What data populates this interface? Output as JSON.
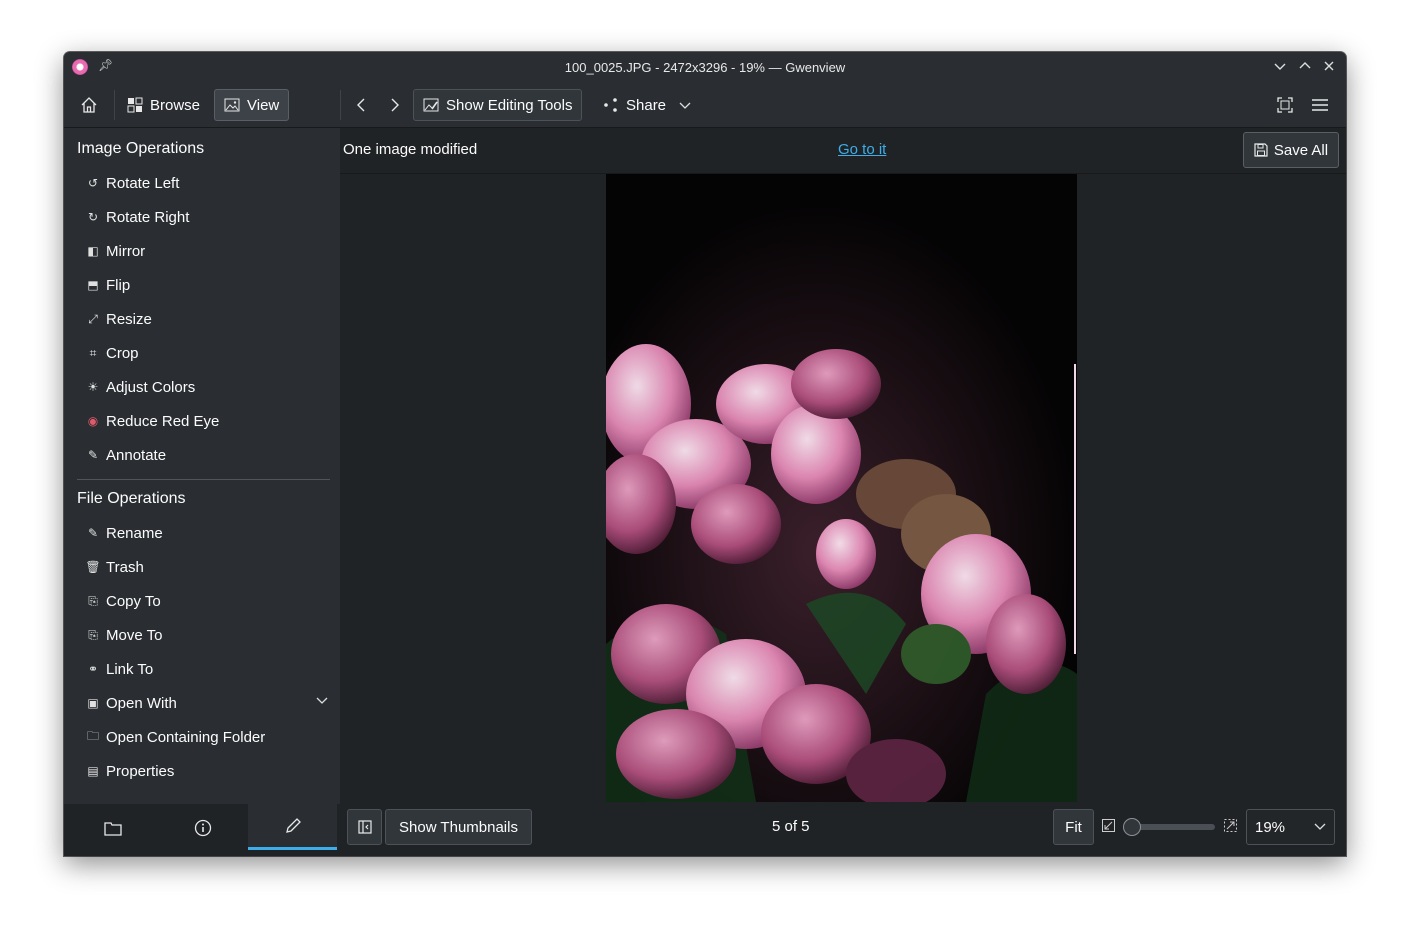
{
  "window": {
    "title": "100_0025.JPG - 2472x3296 - 19% — Gwenview"
  },
  "toolbar": {
    "browse_label": "Browse",
    "view_label": "View",
    "show_editing_tools_label": "Show Editing Tools",
    "share_label": "Share"
  },
  "sidebar": {
    "image_ops_title": "Image Operations",
    "image_ops": [
      {
        "label": "Rotate Left",
        "icon": "rotate-left-icon"
      },
      {
        "label": "Rotate Right",
        "icon": "rotate-right-icon"
      },
      {
        "label": "Mirror",
        "icon": "mirror-icon"
      },
      {
        "label": "Flip",
        "icon": "flip-icon"
      },
      {
        "label": "Resize",
        "icon": "resize-icon"
      },
      {
        "label": "Crop",
        "icon": "crop-icon"
      },
      {
        "label": "Adjust Colors",
        "icon": "adjust-colors-icon"
      },
      {
        "label": "Reduce Red Eye",
        "icon": "red-eye-icon"
      },
      {
        "label": "Annotate",
        "icon": "annotate-icon"
      }
    ],
    "file_ops_title": "File Operations",
    "file_ops": [
      {
        "label": "Rename",
        "icon": "rename-icon"
      },
      {
        "label": "Trash",
        "icon": "trash-icon"
      },
      {
        "label": "Copy To",
        "icon": "copy-icon"
      },
      {
        "label": "Move To",
        "icon": "move-icon"
      },
      {
        "label": "Link To",
        "icon": "link-icon"
      },
      {
        "label": "Open With",
        "icon": "open-with-icon"
      },
      {
        "label": "Open Containing Folder",
        "icon": "folder-icon"
      },
      {
        "label": "Properties",
        "icon": "properties-icon"
      }
    ]
  },
  "banner": {
    "message": "One image modified",
    "link": "Go to it",
    "save_all_label": "Save All"
  },
  "statusbar": {
    "show_thumbnails_label": "Show Thumbnails",
    "counter": "5 of 5",
    "fit_label": "Fit",
    "zoom_value": "19%",
    "zoom_fraction": 0.0
  },
  "colors": {
    "accent": "#3daee9",
    "window_bg": "#202326",
    "panel_bg": "#2a2e32"
  }
}
